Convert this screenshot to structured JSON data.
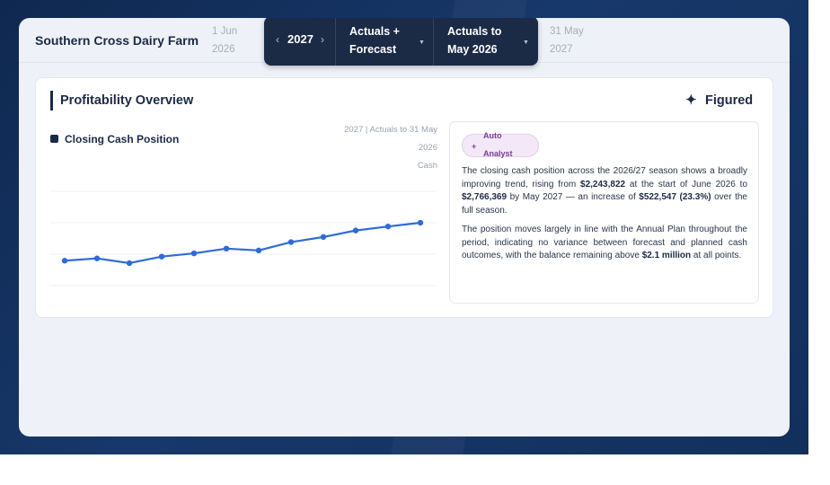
{
  "header": {
    "farm_name": "Southern Cross Dairy Farm",
    "start_date_line1": "1 Jun",
    "start_date_line2": "2026",
    "year": "2027",
    "series_line1": "Actuals +",
    "series_line2": "Forecast",
    "period_line1": "Actuals to",
    "period_line2": "May 2026",
    "end_date_line1": "31 May",
    "end_date_line2": "2027"
  },
  "icons": {
    "year_prev": "chevron-left-icon",
    "year_next": "chevron-right-icon",
    "dropdown": "caret-down-icon",
    "brand": "sparkle-icon",
    "badge": "plus-icon"
  },
  "card": {
    "title": "Profitability Overview",
    "brand": "Figured"
  },
  "chart_note": {
    "line1": "2027 | Actuals to 31 May",
    "line2": "2026",
    "line3": "Cash"
  },
  "colors": {
    "navy": "#1b2a45",
    "line": "#2f6bd6",
    "badge_bg": "#f3e8f8",
    "badge_text": "#7a3d9a"
  },
  "chart_data": {
    "type": "line",
    "title": "",
    "xlabel": "",
    "ylabel": "",
    "ylim": [
      1900000,
      3200000
    ],
    "grid": true,
    "legend": "top-left",
    "series": [
      {
        "name": "Closing Cash Position",
        "values": [
          2243822,
          2275000,
          2210000,
          2300000,
          2345000,
          2410000,
          2385000,
          2500000,
          2570000,
          2660000,
          2715000,
          2766369
        ]
      }
    ]
  },
  "analyst": {
    "badge_line1": "Auto",
    "badge_line2": "Analyst",
    "p1_a": "The closing cash position across the 2026/27 season shows a broadly improving trend, rising from ",
    "p1_b": "$2,243,822",
    "p1_c": " at the start of June 2026 to ",
    "p1_d": "$2,766,369",
    "p1_e": " by May 2027 — an increase of ",
    "p1_f": "$522,547 (23.3%)",
    "p1_g": " over the full season.",
    "p2_a": "The position moves largely in line with the Annual Plan throughout the period, indicating no variance between forecast and planned cash outcomes, with the balance remaining above ",
    "p2_b": "$2.1 million",
    "p2_c": " at all points."
  }
}
